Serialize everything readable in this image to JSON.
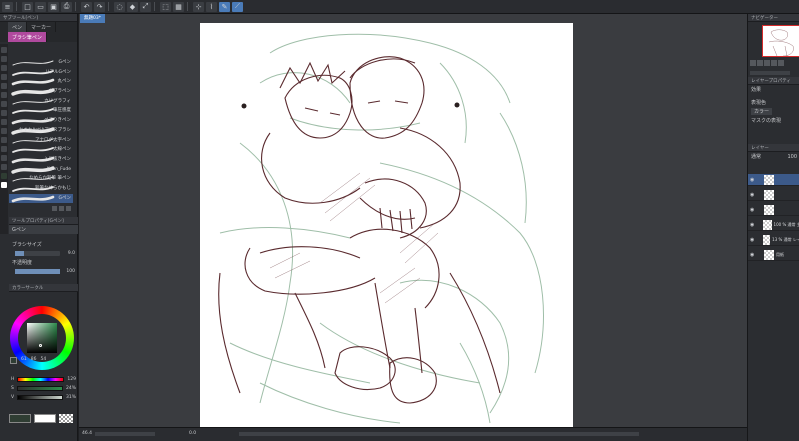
{
  "app": {
    "doc_tab": "無題03*"
  },
  "toolbar": {
    "icons": [
      "menu-icon",
      "new-icon",
      "open-icon",
      "save-icon",
      "print-icon",
      "undo-icon",
      "redo-icon",
      "clear-icon",
      "fill-icon",
      "transform-icon",
      "deselect-icon",
      "select-all-icon",
      "snap-icon",
      "ruler-icon",
      "pen-icon",
      "eraser-icon"
    ]
  },
  "left": {
    "subtool_header": "サブツール[ペン]",
    "tabs": [
      {
        "label": "ペン"
      },
      {
        "label": "マーカー"
      }
    ],
    "group_tab": "ブラシ筆ペン",
    "brushes": [
      {
        "label": "Gペン"
      },
      {
        "label": "リアルGペン"
      },
      {
        "label": "丸ペン"
      },
      {
        "label": "カブラペン"
      },
      {
        "label": "カリグラフィ"
      },
      {
        "label": "筆圧感度"
      },
      {
        "label": "ぺろりきペン"
      },
      {
        "label": "かすれAntiAアンスブラシ"
      },
      {
        "label": "アナログ太字ペン"
      },
      {
        "label": "太線ペン"
      },
      {
        "label": "入り抜きペン"
      },
      {
        "label": "Kaon_Fude"
      },
      {
        "label": "なめらか鉛筆 筆ペン"
      },
      {
        "label": "鉛筆なめらかもじ"
      },
      {
        "label": "Gペン"
      }
    ],
    "tool_property_header": "ツールプロパティ[Gペン]",
    "tool_name": "Gペン",
    "brush_size_label": "ブラシサイズ",
    "brush_size_value": "9.0",
    "opacity_label": "不透明度",
    "opacity_value": "100",
    "color_header": "カラーサークル",
    "hsv_values": [
      "61",
      "86",
      "54"
    ],
    "slider_rows": [
      {
        "label": "H",
        "value": "129"
      },
      {
        "label": "S",
        "value": "24%"
      },
      {
        "label": "V",
        "value": "31%"
      }
    ],
    "main_color": "#2f3d33",
    "sub_color": "#ffffff"
  },
  "right": {
    "navigator_header": "ナビゲーター",
    "layer_property_header": "レイヤープロパティ",
    "effect_label": "効果",
    "display_color_label": "表現色",
    "display_color_value": "カラー",
    "mask_label": "マスクの表現",
    "layer_header": "レイヤー",
    "blend_mode": "通常",
    "opacity": "100",
    "layers": [
      {
        "name": "",
        "selected": true
      },
      {
        "name": "",
        "selected": false
      },
      {
        "name": "",
        "selected": false
      },
      {
        "name": "100 % 通常 主線",
        "selected": false
      },
      {
        "name": "13 % 通常 レイヤー",
        "selected": false
      },
      {
        "name": "用紙",
        "selected": false
      }
    ]
  },
  "status": {
    "zoom": "46.4",
    "angle": "0.0"
  },
  "colors": {
    "accent": "#3c5a8a",
    "sketch_red": "#5a2a2e",
    "sketch_green": "#8fb39a"
  }
}
